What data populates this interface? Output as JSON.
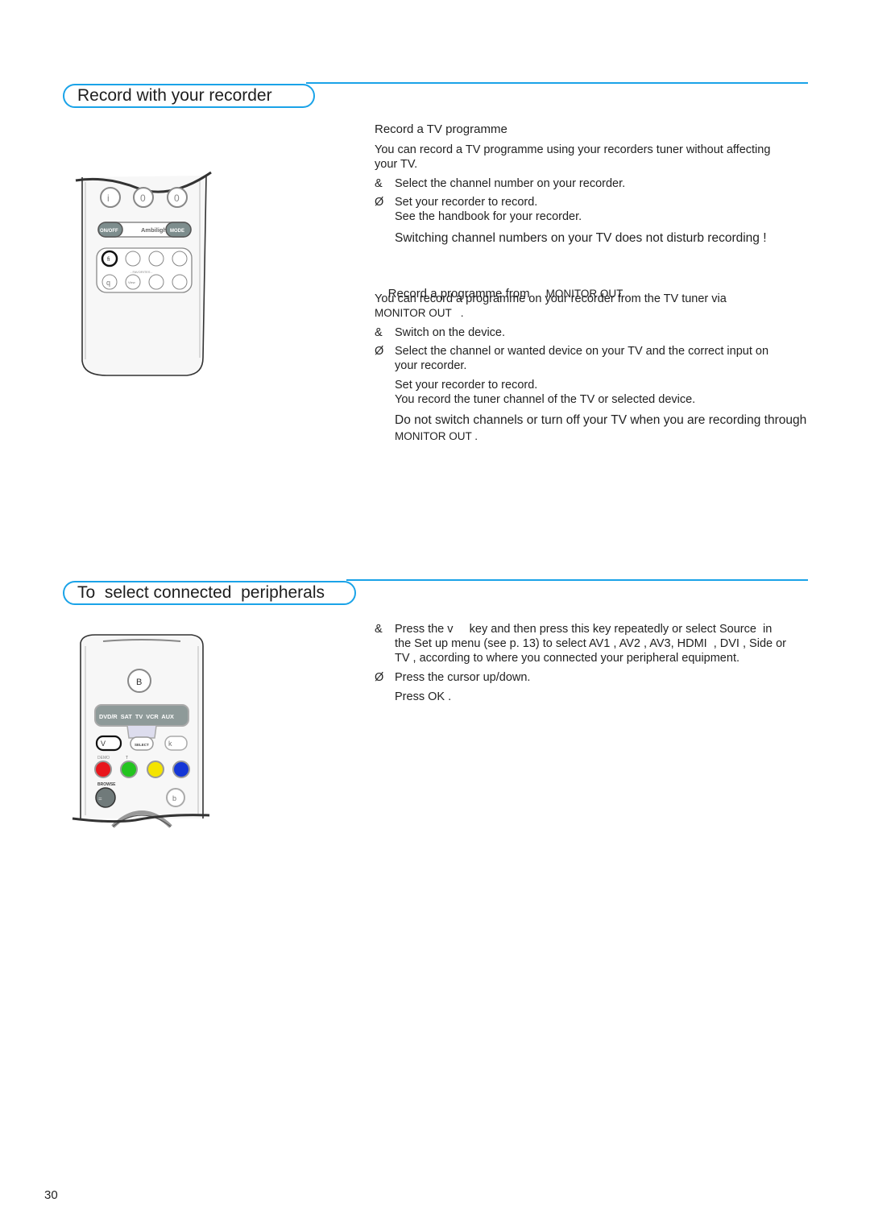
{
  "page_number": "30",
  "accent_color": "#1aa3e8",
  "section1": {
    "title": "Record with your recorder",
    "subsection1": {
      "heading": "Record a TV programme",
      "intro_line1": "You can record a TV programme using your recorders tuner without affecting",
      "intro_line2": "your TV.",
      "steps": [
        {
          "marker": "&",
          "lines": [
            "Select the channel number on your recorder."
          ]
        },
        {
          "marker": "Ø",
          "lines": [
            "Set your recorder to record.",
            "See the handbook for your recorder."
          ]
        }
      ],
      "note": "Switching channel numbers on your TV does not disturb recording !"
    },
    "subsection2": {
      "heading": "Record a programme from",
      "heading_caps": "MONITOR OUT",
      "intro_line1": "You can record a programme on your recorder from the TV tuner via",
      "intro_line2": "MONITOR OUT   .",
      "steps": [
        {
          "marker": "&",
          "lines": [
            "Switch on the device."
          ]
        },
        {
          "marker": "Ø",
          "lines": [
            "Select the channel or wanted device on your TV and the correct input on",
            "your recorder."
          ]
        }
      ],
      "step3_lines": [
        "Set your recorder to record.",
        "You record the tuner channel of the TV or selected device."
      ],
      "note_line1": "Do not switch channels or turn off your TV when you are recording through",
      "note_line2": "MONITOR OUT ."
    },
    "remote": {
      "top_buttons": [
        "i",
        "0",
        "0"
      ],
      "on_off": "ON/OFF",
      "ambilight": "Ambilight",
      "mode": "MODE",
      "highlighted_button": "fi",
      "favorites_label": "- FAVORITES -",
      "bottom_left": "q",
      "view_label": "View"
    }
  },
  "section2": {
    "title": "To  select connected  peripherals",
    "steps": [
      {
        "marker": "&",
        "lines": [
          "Press the v     key and then press this key repeatedly or select Source  in",
          "the Set up menu (see p. 13) to select AV1 , AV2 , AV3, HDMI  , DVI , Side or",
          "TV , according to where you connected your peripheral equipment."
        ]
      },
      {
        "marker": "Ø",
        "lines": [
          "Press the cursor up/down."
        ]
      }
    ],
    "step3": "Press OK .",
    "remote": {
      "top_button": "B",
      "source_bar": "DVD/R  SAT  TV  VCR  AUX",
      "left_key": "V",
      "select_key": "SELECT",
      "right_key": "k",
      "demo_label": "DEMO",
      "t_label": "T",
      "color_keys": {
        "red": "#e8161c",
        "green": "#23c41f",
        "yellow": "#f4e400",
        "blue": "#1436d6"
      },
      "browse_label": "BROWSE",
      "browse_key": "=",
      "b_key": "b"
    }
  }
}
